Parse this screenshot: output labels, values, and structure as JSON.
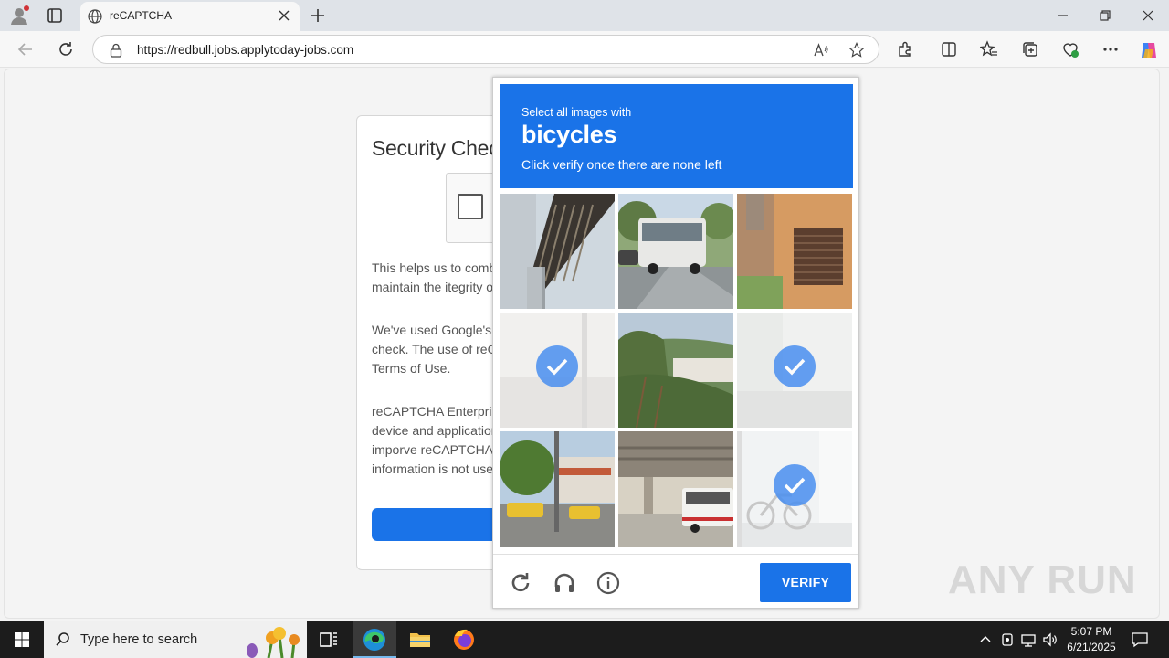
{
  "browser": {
    "tab": {
      "title": "reCAPTCHA",
      "icon": "globe-icon"
    },
    "url": "https://redbull.jobs.applytoday-jobs.com"
  },
  "page": {
    "title": "Security Chec",
    "paragraphs": [
      [
        "This helps us to comba",
        "maintain the itegrity of"
      ],
      [
        "We've used Google's r",
        "check. The use of reCA",
        "Terms of Use."
      ],
      [
        "reCAPTCHA Enterpris",
        "device and application",
        "imporve reCAPTCHA E",
        "information is not used"
      ]
    ]
  },
  "captcha": {
    "instruction": "Select all images with",
    "target": "bicycles",
    "note": "Click verify once there are none left",
    "verify_label": "VERIFY",
    "tiles": [
      {
        "subject": "pole",
        "selected": false
      },
      {
        "subject": "bus",
        "selected": false
      },
      {
        "subject": "building-window",
        "selected": false
      },
      {
        "subject": "street",
        "selected": true
      },
      {
        "subject": "trees",
        "selected": false
      },
      {
        "subject": "street",
        "selected": true
      },
      {
        "subject": "street-cars",
        "selected": false
      },
      {
        "subject": "bus-underpass",
        "selected": false
      },
      {
        "subject": "bicycles",
        "selected": true
      }
    ],
    "accent": "#1a73e8"
  },
  "watermark": "ANY RUN",
  "taskbar": {
    "search_placeholder": "Type here to search",
    "time": "5:07 PM",
    "date": "6/21/2025"
  }
}
